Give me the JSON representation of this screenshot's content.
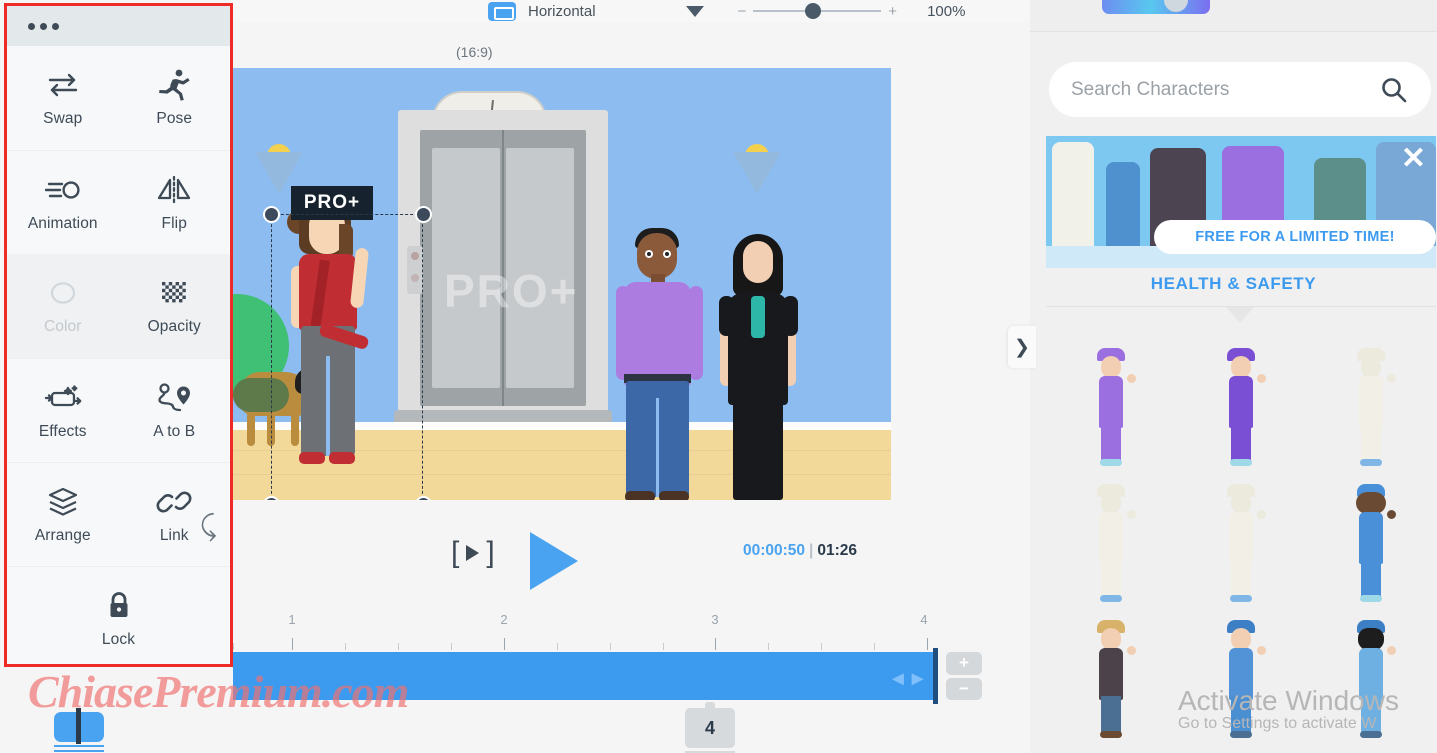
{
  "topbar": {
    "orientation_label": "Horizontal",
    "orientation_icon": "horizontal-canvas-icon",
    "zoom_minus": "−",
    "zoom_plus": "+",
    "zoom_value": "100%",
    "aspect_ratio": "(16:9)"
  },
  "context_panel": {
    "menu_icon": "more-options-icon",
    "items": [
      {
        "label": "Swap",
        "icon": "swap-icon",
        "disabled": false
      },
      {
        "label": "Pose",
        "icon": "pose-icon",
        "disabled": false
      },
      {
        "label": "Animation",
        "icon": "animation-icon",
        "disabled": false
      },
      {
        "label": "Flip",
        "icon": "flip-icon",
        "disabled": false
      },
      {
        "label": "Color",
        "icon": "color-icon",
        "disabled": true
      },
      {
        "label": "Opacity",
        "icon": "opacity-icon",
        "disabled": false
      },
      {
        "label": "Effects",
        "icon": "effects-icon",
        "disabled": false
      },
      {
        "label": "A to B",
        "icon": "a-to-b-icon",
        "disabled": false
      },
      {
        "label": "Arrange",
        "icon": "arrange-icon",
        "disabled": false
      },
      {
        "label": "Link",
        "icon": "link-icon",
        "disabled": false
      },
      {
        "label": "Lock",
        "icon": "lock-icon",
        "disabled": false
      }
    ]
  },
  "stage": {
    "watermark_text": "PRO+",
    "asset_badge": "PRO+"
  },
  "player": {
    "prev_frame_icon": "step-frame-icon",
    "play_icon": "play-icon",
    "current_time": "00:00:50",
    "separator": "|",
    "total_time": "01:26",
    "rotate_icon": "rotate-handle-icon"
  },
  "timeline": {
    "ruler_labels": [
      "1",
      "2",
      "3",
      "4"
    ],
    "zoom_in_label": "+",
    "zoom_out_label": "−",
    "scene_number": "4",
    "drag_handle_icon": "resize-handle-icon"
  },
  "right_panel": {
    "search": {
      "placeholder": "Search Characters",
      "value": "",
      "icon": "search-icon"
    },
    "promo": {
      "banner_text": "FREE FOR A LIMITED TIME!",
      "title": "HEALTH & SAFETY",
      "close_icon": "close-icon"
    },
    "characters": [
      {
        "name": "surgeon-purple-female",
        "cap": "#9b6fe0",
        "body": "#9b6fe0",
        "legs": "#9b6fe0",
        "feet": "#9fd9e8",
        "hair": "#9b6fe0"
      },
      {
        "name": "surgeon-purple-male",
        "cap": "#7b4fd4",
        "body": "#7b4fd4",
        "legs": "#7b4fd4",
        "feet": "#9fd9e8",
        "hair": "#7b4fd4"
      },
      {
        "name": "hazmat-white-1",
        "cap": "#eceadd",
        "body": "#f2f0e6",
        "legs": "#f2f0e6",
        "feet": "#7fb6e5",
        "hair": "#eceadd"
      },
      {
        "name": "hazmat-white-2",
        "cap": "#eceadd",
        "body": "#f2f0e6",
        "legs": "#f2f0e6",
        "feet": "#7fb6e5",
        "hair": "#eceadd"
      },
      {
        "name": "hazmat-white-3",
        "cap": "#eceadd",
        "body": "#f2f0e6",
        "legs": "#f2f0e6",
        "feet": "#7fb6e5",
        "hair": "#eceadd"
      },
      {
        "name": "nurse-blue-female",
        "cap": "#4a90d9",
        "body": "#4a90d9",
        "legs": "#4a90d9",
        "feet": "#9fd9e8",
        "hair": "#1d1d1d"
      },
      {
        "name": "casual-male-grey",
        "cap": "#d9b26a",
        "body": "#4b424a",
        "legs": "#4a6f93",
        "feet": "#6b4a33",
        "hair": "#d9b26a"
      },
      {
        "name": "nurse-blue-male",
        "cap": "#3d7fc4",
        "body": "#5193d6",
        "legs": "#4a8fd2",
        "feet": "#4a6f93",
        "hair": "#3d7fc4"
      },
      {
        "name": "nurse-blue-female-2",
        "cap": "#3d7fc4",
        "body": "#6fb0e3",
        "legs": "#6fb0e3",
        "feet": "#4a6f93",
        "hair": "#1d1d1d"
      }
    ],
    "collapse_icon": "chevron-right-icon"
  },
  "overlays": {
    "watermark": "ChiasePremium.com",
    "activate_title": "Activate Windows",
    "activate_subtitle": "Go to Settings to activate W"
  },
  "colors": {
    "accent_blue": "#4aa3f0",
    "timeline_blue": "#3d9bef",
    "panel_border_red": "#ee2b26",
    "text_dark": "#3e4b57"
  }
}
